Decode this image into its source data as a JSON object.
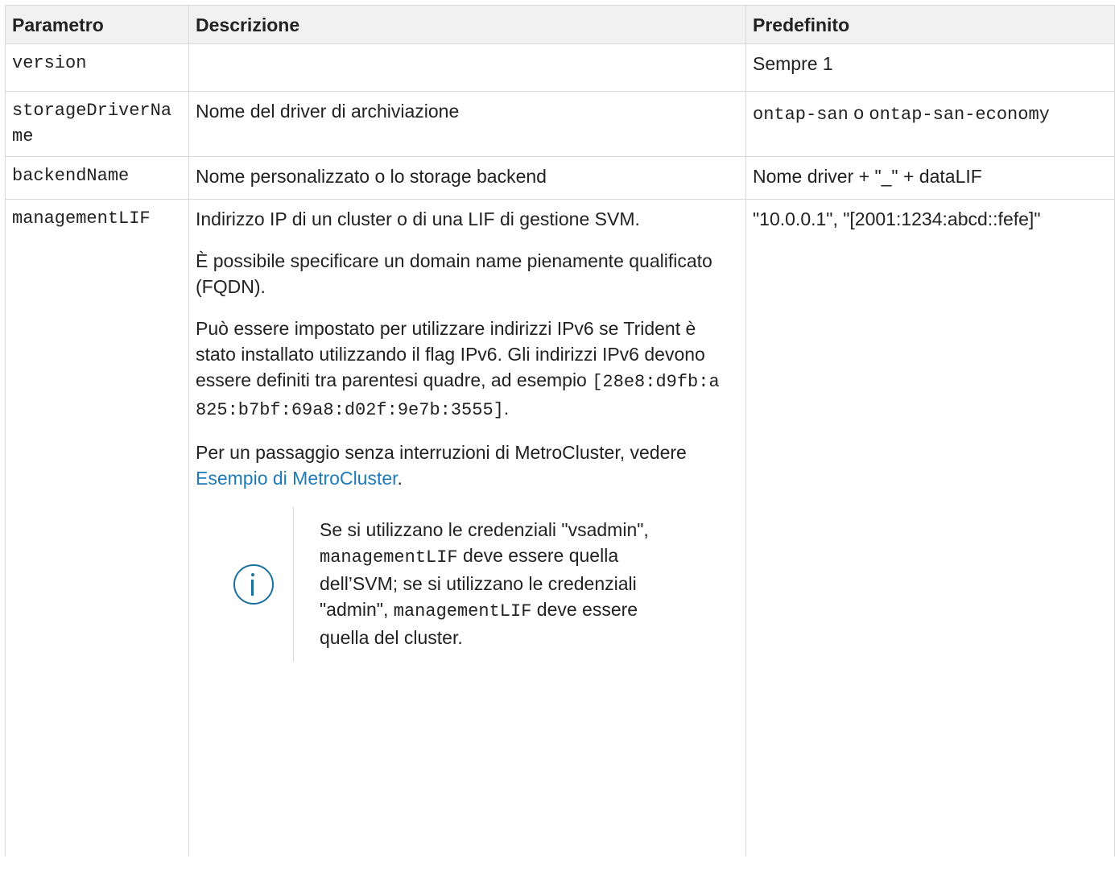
{
  "table": {
    "headers": {
      "param": "Parametro",
      "desc": "Descrizione",
      "default": "Predefinito"
    },
    "rows": {
      "version": {
        "param": "version",
        "desc": "",
        "default": "Sempre 1"
      },
      "storageDriverName": {
        "param": "storageDriverName",
        "desc": "Nome del driver di archiviazione",
        "default_code1": "ontap-san",
        "default_sep": " o ",
        "default_code2": "ontap-san-economy"
      },
      "backendName": {
        "param": "backendName",
        "desc": "Nome personalizzato o lo storage backend",
        "default": "Nome driver + \"_\" + dataLIF"
      },
      "managementLIF": {
        "param": "managementLIF",
        "desc_p1": "Indirizzo IP di un cluster o di una LIF di gestione SVM.",
        "desc_p2": "È possibile specificare un domain name pienamente qualificato (FQDN).",
        "desc_p3": "Può essere impostato per utilizzare indirizzi IPv6 se Trident è stato installato utilizzando il flag IPv6. Gli indirizzi IPv6 devono essere definiti tra parentesi quadre, ad esempio ",
        "desc_p3_code": "[28e8:d9fb:a825:b7bf:69a8:d02f:9e7b:3555]",
        "desc_p3_end": ".",
        "desc_p4_text": "Per un passaggio senza interruzioni di MetroCluster, vedere ",
        "desc_p4_link": "Esempio di MetroCluster",
        "desc_p4_end": ".",
        "note": {
          "icon": "info-icon",
          "t1": "Se si utilizzano le credenziali \"vsadmin\", ",
          "c1": "managementLIF",
          "t2": " deve essere quella dell’SVM; se si utilizzano le credenziali \"admin\", ",
          "c2": "managementLIF",
          "t3": " deve essere quella del cluster."
        },
        "default": "\"10.0.0.1\", \"[2001:1234:abcd::fefe]\""
      }
    }
  }
}
